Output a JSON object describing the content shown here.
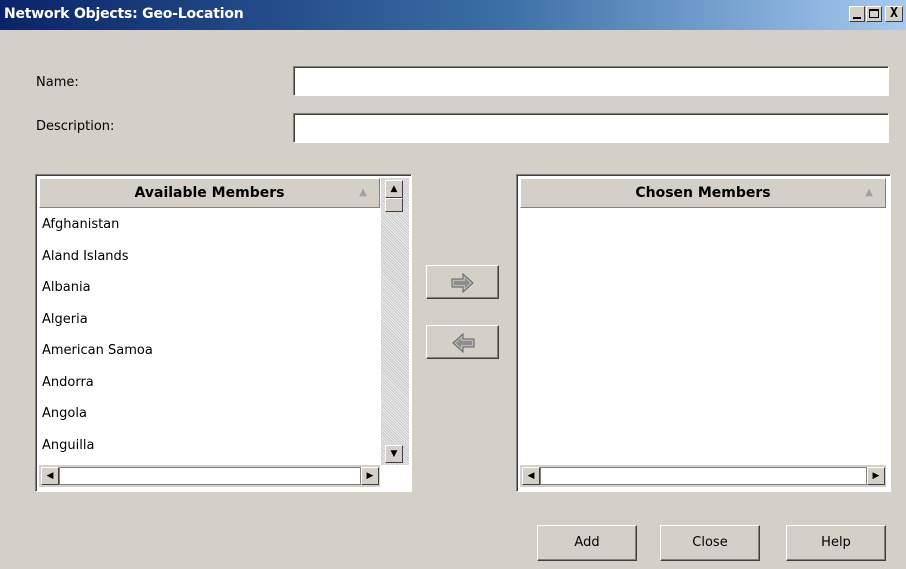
{
  "window": {
    "title": "Network Objects: Geo-Location",
    "controls": {
      "minimize": "_",
      "maximize": "□",
      "close": "X"
    }
  },
  "form": {
    "name_label": "Name:",
    "name_value": "",
    "description_label": "Description:",
    "description_value": ""
  },
  "available": {
    "header": "Available Members",
    "items": [
      "Afghanistan",
      "Aland Islands",
      "Albania",
      "Algeria",
      "American Samoa",
      "Andorra",
      "Angola",
      "Anguilla"
    ]
  },
  "chosen": {
    "header": "Chosen Members",
    "items": []
  },
  "icons": {
    "move_right": "right-arrow-icon",
    "move_left": "left-arrow-icon",
    "sort": "sort-ascending-icon"
  },
  "buttons": {
    "add": "Add",
    "close": "Close",
    "help": "Help"
  }
}
